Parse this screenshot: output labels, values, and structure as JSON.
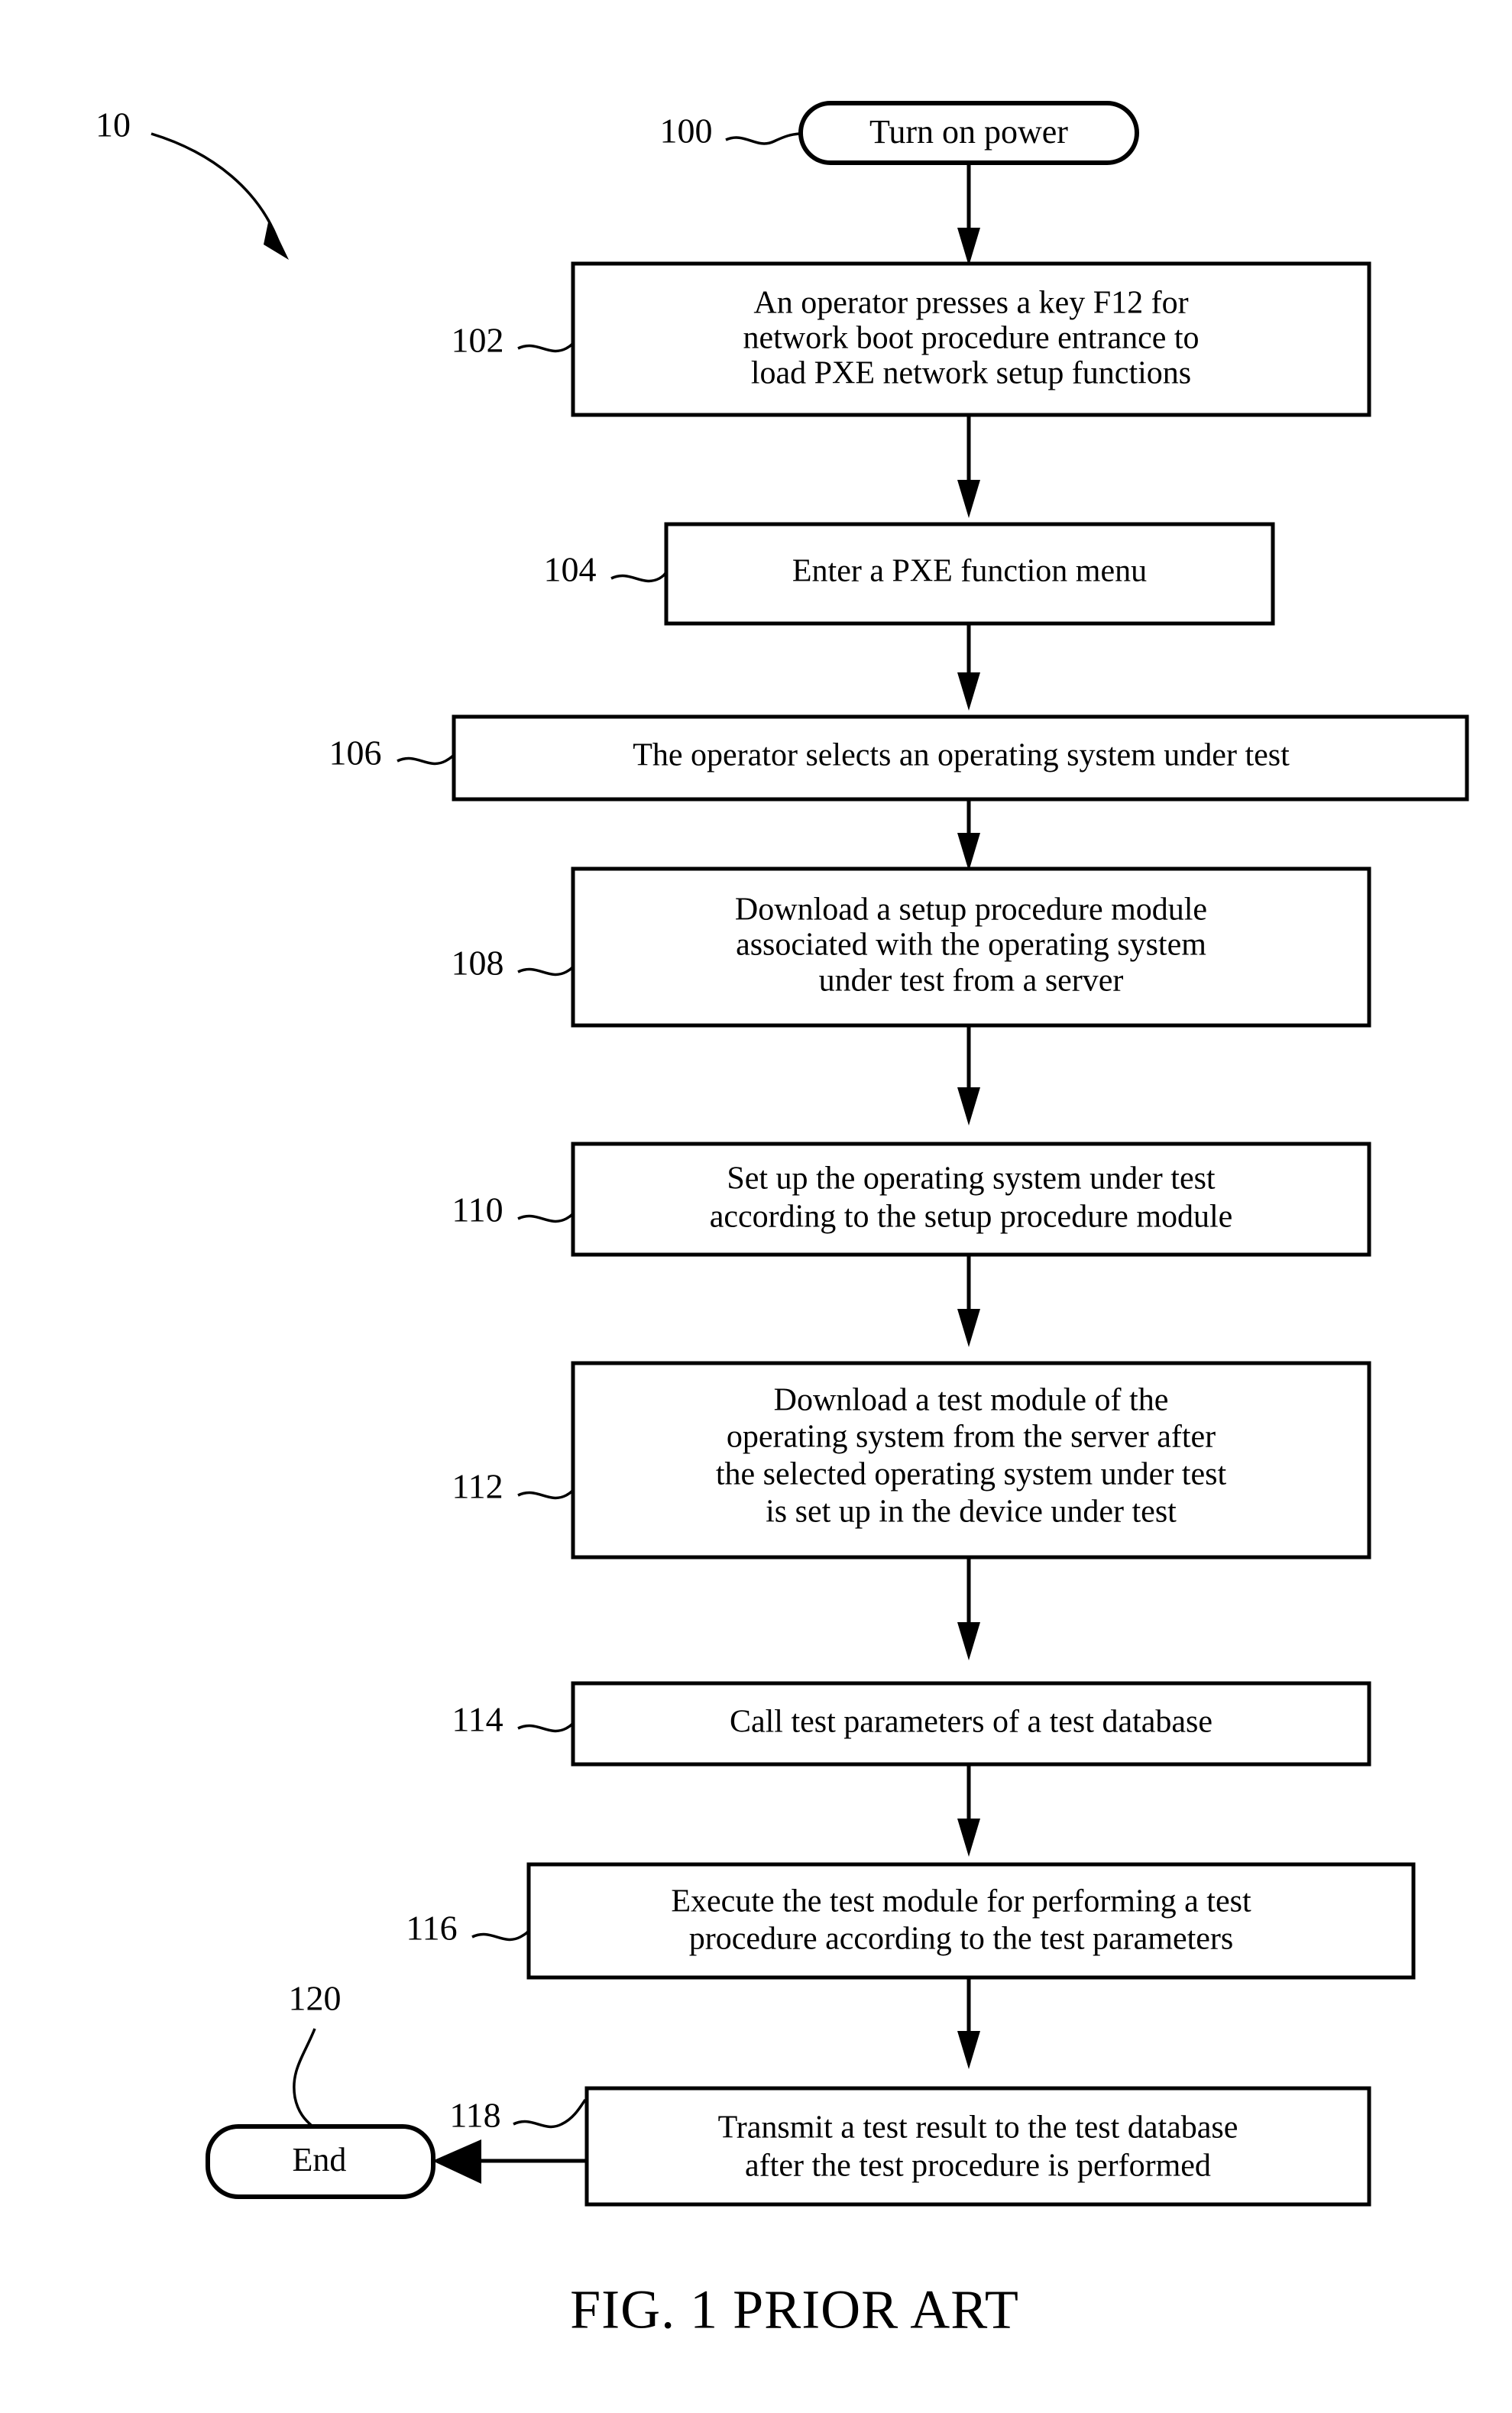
{
  "figure": {
    "caption": "FIG. 1 PRIOR ART",
    "assembly_ref": "10"
  },
  "nodes": [
    {
      "ref": "100",
      "shape": "terminal",
      "lines": [
        "Turn on power"
      ]
    },
    {
      "ref": "102",
      "shape": "process",
      "lines": [
        "An operator presses a key F12 for",
        "network boot procedure entrance to",
        "load PXE network setup functions"
      ]
    },
    {
      "ref": "104",
      "shape": "process",
      "lines": [
        "Enter a PXE function menu"
      ]
    },
    {
      "ref": "106",
      "shape": "process",
      "lines": [
        "The operator selects an operating system under test"
      ]
    },
    {
      "ref": "108",
      "shape": "process",
      "lines": [
        "Download a setup procedure module",
        "associated with the operating system",
        "under test from a server"
      ]
    },
    {
      "ref": "110",
      "shape": "process",
      "lines": [
        "Set up the operating system under test",
        "according to the setup procedure module"
      ]
    },
    {
      "ref": "112",
      "shape": "process",
      "lines": [
        "Download a test module of the",
        "operating system from the server after",
        "the selected operating system under test",
        "is set up in the device under test"
      ]
    },
    {
      "ref": "114",
      "shape": "process",
      "lines": [
        "Call test parameters of a test database"
      ]
    },
    {
      "ref": "116",
      "shape": "process",
      "lines": [
        "Execute the test module for performing a test",
        "procedure according to the test parameters"
      ]
    },
    {
      "ref": "118",
      "shape": "process",
      "lines": [
        "Transmit a test result to the test database",
        "after the test procedure is performed"
      ]
    },
    {
      "ref": "120",
      "shape": "terminal",
      "lines": [
        "End"
      ]
    }
  ],
  "text": {
    "n100_l1": "Turn on power",
    "n102_l1": "An operator presses a key F12 for",
    "n102_l2": "network boot procedure entrance to",
    "n102_l3": "load PXE network setup functions",
    "n104_l1": "Enter a PXE function menu",
    "n106_l1": "The operator selects an operating system under test",
    "n108_l1": "Download a setup procedure module",
    "n108_l2": "associated with the operating system",
    "n108_l3": "under test from a server",
    "n110_l1": "Set up the operating system under test",
    "n110_l2": "according to the setup procedure module",
    "n112_l1": "Download a test module of the",
    "n112_l2": "operating system from the server after",
    "n112_l3": "the selected operating system under test",
    "n112_l4": "is set up in the device under test",
    "n114_l1": "Call test parameters of a test database",
    "n116_l1": "Execute the test module for performing a test",
    "n116_l2": "procedure according to the test parameters",
    "n118_l1": "Transmit a test result to the test database",
    "n118_l2": "after the test procedure is performed",
    "n120_l1": "End"
  },
  "refs": {
    "assembly": "10",
    "r100": "100",
    "r102": "102",
    "r104": "104",
    "r106": "106",
    "r108": "108",
    "r110": "110",
    "r112": "112",
    "r114": "114",
    "r116": "116",
    "r118": "118",
    "r120": "120"
  },
  "colors": {
    "ink": "#000000",
    "paper": "#ffffff"
  }
}
